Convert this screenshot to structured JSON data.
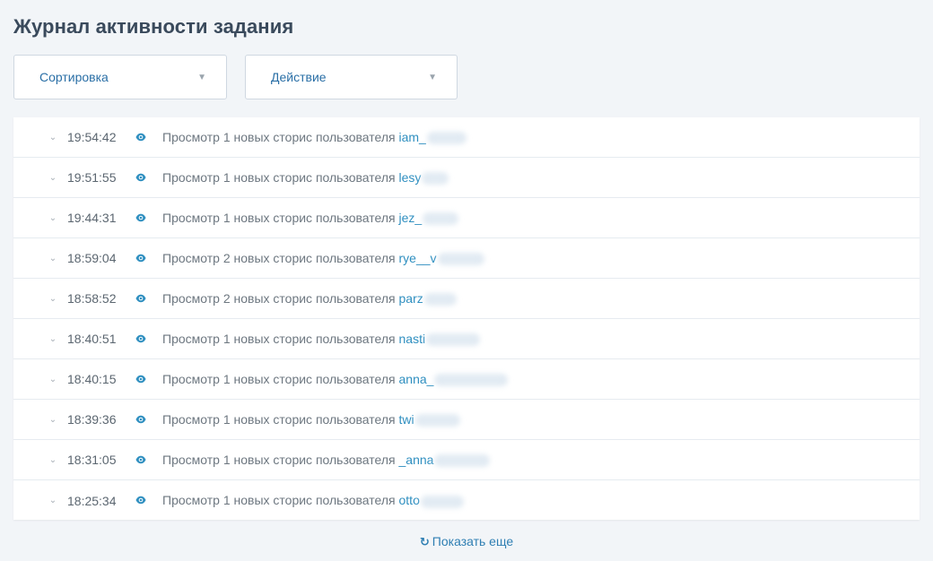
{
  "header": {
    "title": "Журнал активности задания"
  },
  "filters": {
    "sort_label": "Сортировка",
    "action_label": "Действие",
    "caret": "▼"
  },
  "icons": {
    "expand": "chevron-down-icon",
    "view": "eye-icon",
    "refresh": "refresh-icon"
  },
  "colors": {
    "link": "#2f8fc0",
    "accent": "#2f7fb3"
  },
  "log": {
    "rows": [
      {
        "time": "19:54:42",
        "prefix": "Просмотр 1 новых сторис пользователя",
        "user": "iam_"
      },
      {
        "time": "19:51:55",
        "prefix": "Просмотр 1 новых сторис пользователя",
        "user": "lesy"
      },
      {
        "time": "19:44:31",
        "prefix": "Просмотр 1 новых сторис пользователя",
        "user": "jez_"
      },
      {
        "time": "18:59:04",
        "prefix": "Просмотр 2 новых сторис пользователя",
        "user": "rye__v"
      },
      {
        "time": "18:58:52",
        "prefix": "Просмотр 2 новых сторис пользователя",
        "user": "parz"
      },
      {
        "time": "18:40:51",
        "prefix": "Просмотр 1 новых сторис пользователя",
        "user": "nasti"
      },
      {
        "time": "18:40:15",
        "prefix": "Просмотр 1 новых сторис пользователя",
        "user": "anna_"
      },
      {
        "time": "18:39:36",
        "prefix": "Просмотр 1 новых сторис пользователя",
        "user": "twi"
      },
      {
        "time": "18:31:05",
        "prefix": "Просмотр 1 новых сторис пользователя",
        "user": "_anna"
      },
      {
        "time": "18:25:34",
        "prefix": "Просмотр 1 новых сторис пользователя",
        "user": "otto"
      }
    ]
  },
  "footer": {
    "more_label": "Показать еще",
    "more_icon_glyph": "↻"
  }
}
